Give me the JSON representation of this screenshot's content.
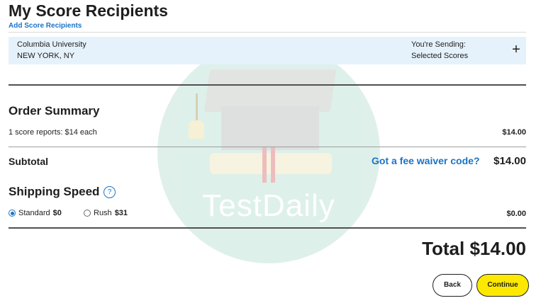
{
  "header": {
    "title": "My Score Recipients",
    "add_link": "Add Score Recipients"
  },
  "recipient": {
    "name": "Columbia University",
    "location": "NEW YORK, NY",
    "sending_label": "You're Sending:",
    "sending_value": "Selected Scores",
    "expand_icon": "+"
  },
  "order_summary": {
    "title": "Order Summary",
    "line_item": "1 score reports: $14 each",
    "line_amount": "$14.00",
    "subtotal_label": "Subtotal",
    "fee_waiver_link": "Got a fee waiver code?",
    "subtotal_amount": "$14.00"
  },
  "shipping": {
    "title": "Shipping Speed",
    "help_icon": "?",
    "options": [
      {
        "label": "Standard",
        "price": "$0",
        "selected": true
      },
      {
        "label": "Rush",
        "price": "$31",
        "selected": false
      }
    ],
    "amount": "$0.00"
  },
  "total": {
    "label": "Total $14.00"
  },
  "buttons": {
    "back": "Back",
    "continue": "Continue"
  },
  "watermark": {
    "text": "TestDaily"
  },
  "colors": {
    "link": "#1a73c6",
    "recipient_bg": "#e6f2fb",
    "continue_bg": "#fde900"
  }
}
